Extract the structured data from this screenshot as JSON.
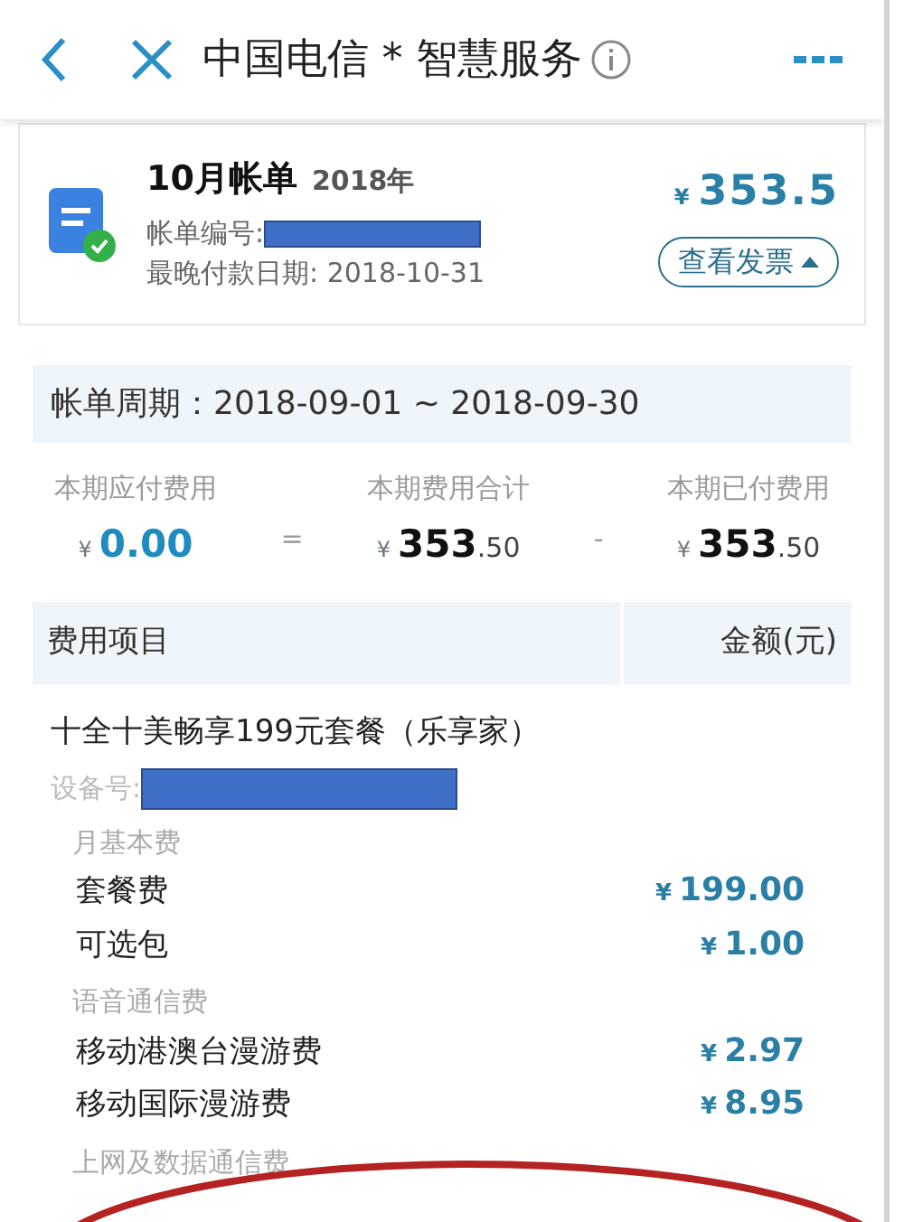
{
  "header": {
    "title": "中国电信 * 智慧服务"
  },
  "bill": {
    "title": "10月帐单",
    "year": "2018年",
    "currency": "¥",
    "amount": "353.5",
    "number_label": "帐单编号:",
    "due_date": "最晚付款日期: 2018-10-31",
    "invoice_button": "查看发票"
  },
  "period": "帐单周期：2018-09-01 ~ 2018-09-30",
  "summary": [
    {
      "kind": "due",
      "label": "本期应付费用",
      "currency": "¥",
      "amount": "0.00"
    },
    {
      "kind": "operator",
      "symbol": "="
    },
    {
      "kind": "total",
      "label": "本期费用合计",
      "currency": "¥",
      "amount": "353",
      "fraction": ".50"
    },
    {
      "kind": "operator",
      "symbol": "-"
    },
    {
      "kind": "total",
      "label": "本期已付费用",
      "currency": "¥",
      "amount": "353",
      "fraction": ".50"
    }
  ],
  "table": {
    "columns": [
      "费用项目",
      "金额(元)"
    ],
    "plan": "十全十美畅享199元套餐（乐享家）",
    "device_label": "设备号:",
    "groups": [
      {
        "name": "月基本费",
        "items": [
          {
            "name": "套餐费",
            "currency": "¥",
            "amount": "199.00"
          },
          {
            "name": "可选包",
            "currency": "¥",
            "amount": "1.00"
          }
        ]
      },
      {
        "name": "语音通信费",
        "items": [
          {
            "name": "移动港澳台漫游费",
            "currency": "¥",
            "amount": "2.97"
          },
          {
            "name": "移动国际漫游费",
            "currency": "¥",
            "amount": "8.95"
          }
        ]
      },
      {
        "name": "上网及数据通信费"
      }
    ]
  }
}
